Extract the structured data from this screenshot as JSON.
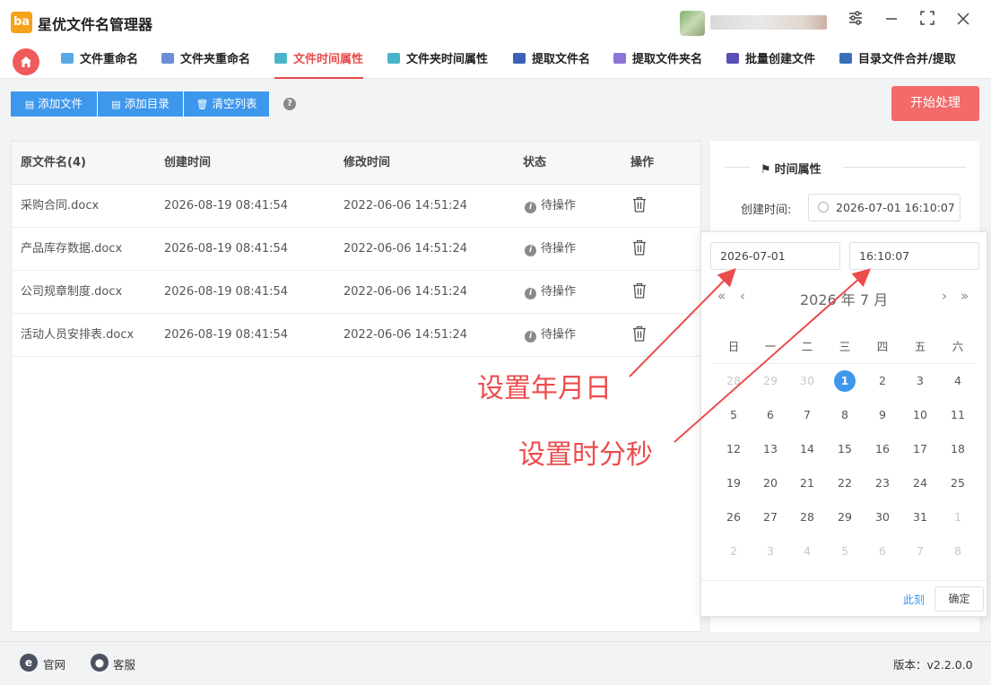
{
  "app": {
    "title": "星优文件名管理器",
    "logo_text": "ba"
  },
  "window_controls": {
    "settings_icon": "sliders-icon",
    "minimize_icon": "minimize-icon",
    "maximize_icon": "maximize-icon",
    "close_icon": "close-icon"
  },
  "tabs": [
    {
      "label": "文件重命名",
      "active": false,
      "icon_color": "#56a9e6"
    },
    {
      "label": "文件夹重命名",
      "active": false,
      "icon_color": "#6a8fd6"
    },
    {
      "label": "文件时间属性",
      "active": true,
      "icon_color": "#4ab5c9"
    },
    {
      "label": "文件夹时间属性",
      "active": false,
      "icon_color": "#4ab5c9"
    },
    {
      "label": "提取文件名",
      "active": false,
      "icon_color": "#3c62b8"
    },
    {
      "label": "提取文件夹名",
      "active": false,
      "icon_color": "#8b74d6"
    },
    {
      "label": "批量创建文件",
      "active": false,
      "icon_color": "#5a4fb6"
    },
    {
      "label": "目录文件合并/提取",
      "active": false,
      "icon_color": "#3a70b8"
    }
  ],
  "toolbar": {
    "add_file": "添加文件",
    "add_dir": "添加目录",
    "clear_list": "清空列表",
    "start": "开始处理"
  },
  "table": {
    "headers": [
      "原文件名(4)",
      "创建时间",
      "修改时间",
      "状态",
      "操作"
    ],
    "rows": [
      {
        "name": "采购合同.docx",
        "created": "2026-08-19 08:41:54",
        "modified": "2022-06-06 14:51:24",
        "status": "待操作"
      },
      {
        "name": "产品库存数据.docx",
        "created": "2026-08-19 08:41:54",
        "modified": "2022-06-06 14:51:24",
        "status": "待操作"
      },
      {
        "name": "公司规章制度.docx",
        "created": "2026-08-19 08:41:54",
        "modified": "2022-06-06 14:51:24",
        "status": "待操作"
      },
      {
        "name": "活动人员安排表.docx",
        "created": "2026-08-19 08:41:54",
        "modified": "2022-06-06 14:51:24",
        "status": "待操作"
      }
    ]
  },
  "panel": {
    "title": "时间属性",
    "created_label": "创建时间:",
    "created_value": "2026-07-01 16:10:07"
  },
  "picker": {
    "date_value": "2026-07-01",
    "time_value": "16:10:07",
    "header": "2026 年  7 月",
    "weekdays": [
      "日",
      "一",
      "二",
      "三",
      "四",
      "五",
      "六"
    ],
    "weeks": [
      [
        "28",
        "29",
        "30",
        "1",
        "2",
        "3",
        "4"
      ],
      [
        "5",
        "6",
        "7",
        "8",
        "9",
        "10",
        "11"
      ],
      [
        "12",
        "13",
        "14",
        "15",
        "16",
        "17",
        "18"
      ],
      [
        "19",
        "20",
        "21",
        "22",
        "23",
        "24",
        "25"
      ],
      [
        "26",
        "27",
        "28",
        "29",
        "30",
        "31",
        "1"
      ],
      [
        "2",
        "3",
        "4",
        "5",
        "6",
        "7",
        "8"
      ]
    ],
    "selected_day": "1",
    "now_label": "此刻",
    "ok_label": "确定"
  },
  "annotations": {
    "set_date": "设置年月日",
    "set_time": "设置时分秒",
    "color": "#ec4c4c"
  },
  "statusbar": {
    "website": "官网",
    "service": "客服",
    "version": "版本：v2.2.0.0"
  }
}
